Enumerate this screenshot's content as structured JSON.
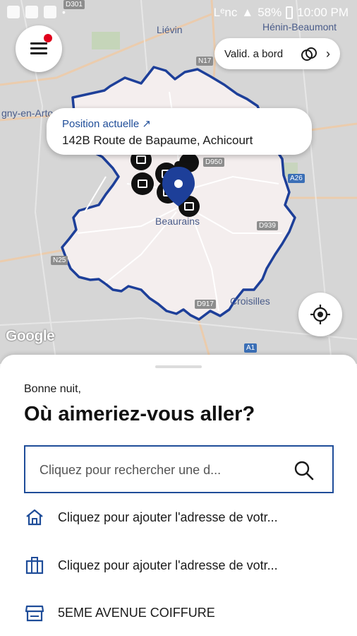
{
  "status_bar": {
    "net_label": "Lᵉnc",
    "battery": "58%",
    "time": "10:00 PM"
  },
  "map": {
    "place_labels": [
      "Liévin",
      "Hénin-Beaumont",
      "gny-en-Arto",
      "Beaurains",
      "Croisilles"
    ],
    "road_labels": [
      "D301",
      "N17",
      "D950",
      "A26",
      "D939",
      "N25",
      "D917",
      "A1"
    ],
    "google_logo": "Google"
  },
  "top_controls": {
    "menu_icon": "hamburger-menu-icon",
    "notification_color": "#e0001b",
    "validation_label": "Valid. a bord"
  },
  "position": {
    "label": "Position actuelle ↗",
    "address": "142B Route de Bapaume, Achicourt"
  },
  "sheet": {
    "greeting": "Bonne nuit,",
    "question": "Où aimeriez-vous aller?",
    "search_placeholder": "Cliquez pour rechercher une d...",
    "items": [
      {
        "icon": "home-icon",
        "label": "Cliquez pour ajouter l'adresse de votr..."
      },
      {
        "icon": "briefcase-icon",
        "label": "Cliquez pour ajouter l'adresse de votr..."
      },
      {
        "icon": "store-icon",
        "label": "5EME AVENUE COIFFURE"
      }
    ]
  },
  "colors": {
    "accent": "#1f4d99",
    "zone_border": "#1d3f99",
    "pin": "#1d3f99"
  }
}
